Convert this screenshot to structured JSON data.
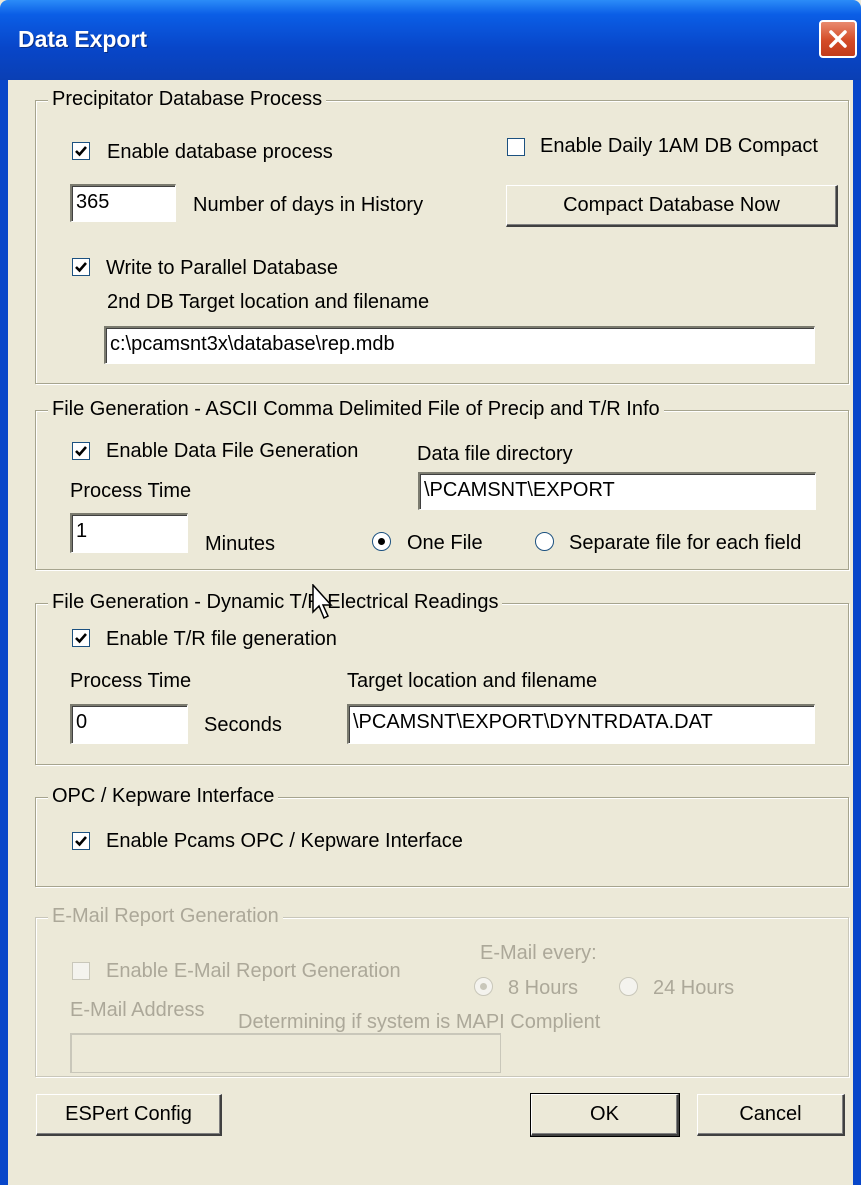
{
  "window": {
    "title": "Data Export"
  },
  "precip_group": {
    "legend": "Precipitator Database Process",
    "enable_db_label": "Enable database process",
    "enable_db_checked": true,
    "enable_compact_label": "Enable Daily 1AM DB Compact",
    "enable_compact_checked": false,
    "days_value": "365",
    "days_label": "Number of days in History",
    "compact_button": "Compact Database Now",
    "parallel_label": "Write to Parallel Database",
    "parallel_checked": true,
    "target_label": "2nd DB Target location and filename",
    "target_value": "c:\\pcamsnt3x\\database\\rep.mdb"
  },
  "ascii_group": {
    "legend": "File Generation - ASCII Comma Delimited File of Precip and T/R Info",
    "enable_label": "Enable Data File Generation",
    "enable_checked": true,
    "dir_label": "Data file directory",
    "dir_value": "\\PCAMSNT\\EXPORT",
    "process_time_label": "Process Time",
    "process_time_value": "1",
    "minutes_label": "Minutes",
    "one_file_label": "One File",
    "separate_label": "Separate file for each field",
    "selected": "One File"
  },
  "dynamic_group": {
    "legend": "File Generation - Dynamic T/R Electrical Readings",
    "enable_label": "Enable T/R file generation",
    "enable_checked": true,
    "process_time_label": "Process Time",
    "process_time_value": "0",
    "seconds_label": "Seconds",
    "target_label": "Target location and filename",
    "target_value": "\\PCAMSNT\\EXPORT\\DYNTRDATA.DAT"
  },
  "opc_group": {
    "legend": "OPC / Kepware Interface",
    "enable_label": "Enable Pcams OPC / Kepware Interface",
    "enable_checked": true
  },
  "email_group": {
    "legend": "E-Mail Report Generation",
    "enable_label": "Enable E-Mail Report Generation",
    "enable_checked": false,
    "every_label": "E-Mail every:",
    "hours8_label": "8 Hours",
    "hours24_label": "24 Hours",
    "selected": "8 Hours",
    "address_label": "E-Mail Address",
    "status_text": "Determining if system is MAPI Complient",
    "address_value": ""
  },
  "buttons": {
    "espert": "ESPert Config",
    "ok": "OK",
    "cancel": "Cancel"
  },
  "colors": {
    "titlebar": "#0846c9",
    "dialog_bg": "#ece9d8",
    "close": "#d44b27",
    "disabled_text": "#aca899"
  }
}
